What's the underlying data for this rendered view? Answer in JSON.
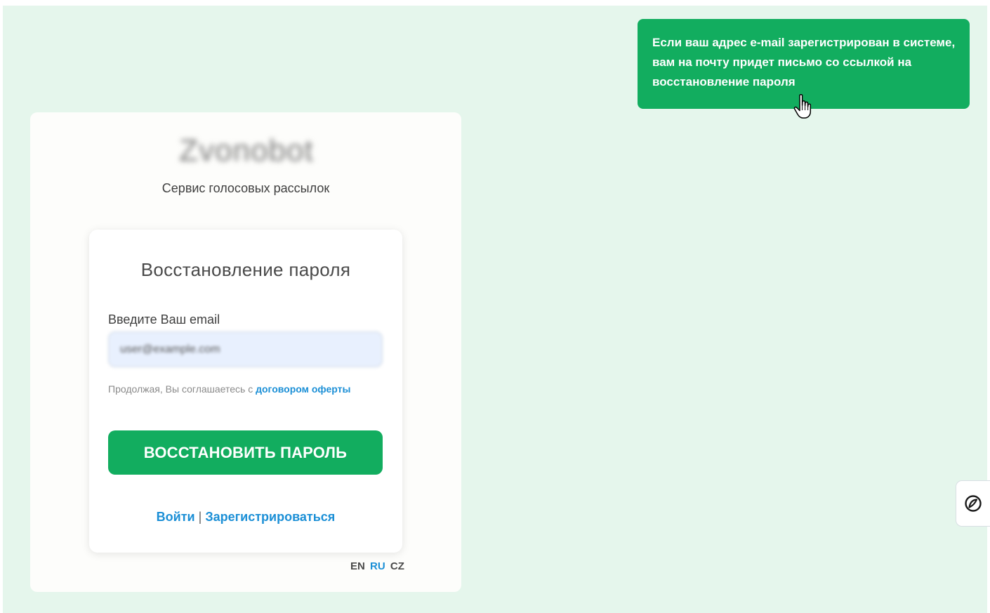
{
  "notification": {
    "message": "Если ваш адрес e-mail зарегистрирован в системе, вам на почту придет письмо со ссылкой на восстановление пароля"
  },
  "brand": {
    "logo_text": "Zvonobot",
    "tagline": "Сервис голосовых рассылок"
  },
  "reset_form": {
    "title": "Восстановление пароля",
    "email_label": "Введите Ваш email",
    "email_value": "user@example.com",
    "terms_prefix": "Продолжая, Вы соглашаетесь с ",
    "terms_link": "договором оферты",
    "submit_label": "ВОССТАНОВИТЬ ПАРОЛЬ"
  },
  "auth_links": {
    "login": "Войти",
    "separator": "|",
    "register": "Зарегистрироваться"
  },
  "languages": [
    {
      "code": "EN"
    },
    {
      "code": "RU",
      "active": true
    },
    {
      "code": "CZ"
    }
  ],
  "side_widget": {
    "icon": "chat-widget-icon"
  },
  "colors": {
    "background": "#e5f6ec",
    "accent_green": "#12ad5f",
    "link_blue": "#1b8fd6"
  }
}
